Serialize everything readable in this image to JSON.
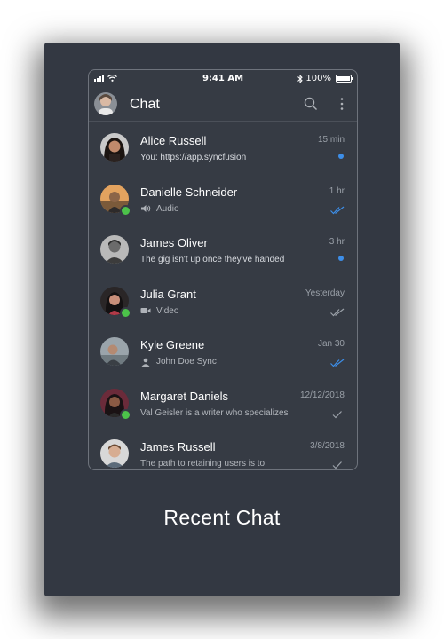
{
  "status_bar": {
    "time": "9:41 AM",
    "battery": "100%"
  },
  "header": {
    "title": "Chat"
  },
  "chats": [
    {
      "name": "Alice Russell",
      "time": "15 min",
      "preview": "You: https://app.syncfusion",
      "preview_icon": "",
      "status": "unread",
      "online": false
    },
    {
      "name": "Danielle Schneider",
      "time": "1 hr",
      "preview": "Audio",
      "preview_icon": "speaker-icon",
      "status": "read",
      "online": true
    },
    {
      "name": "James Oliver",
      "time": "3 hr",
      "preview": "The gig isn't up once they've handed",
      "preview_icon": "",
      "status": "unread",
      "online": false
    },
    {
      "name": "Julia Grant",
      "time": "Yesterday",
      "preview": "Video",
      "preview_icon": "video-icon",
      "status": "delivered",
      "online": true
    },
    {
      "name": "Kyle Greene",
      "time": "Jan 30",
      "preview": "John Doe Sync",
      "preview_icon": "contact-icon",
      "status": "read",
      "online": false
    },
    {
      "name": "Margaret Daniels",
      "time": "12/12/2018",
      "preview": "Val Geisler is a writer who specializes",
      "preview_icon": "",
      "status": "sent",
      "online": true
    },
    {
      "name": "James Russell",
      "time": "3/8/2018",
      "preview": "The path to retaining users is to",
      "preview_icon": "",
      "status": "sent",
      "online": false
    }
  ],
  "caption": "Recent Chat",
  "colors": {
    "card_background": "#333842",
    "accent_blue": "#3d8ee8",
    "online_green": "#4cc24a"
  }
}
